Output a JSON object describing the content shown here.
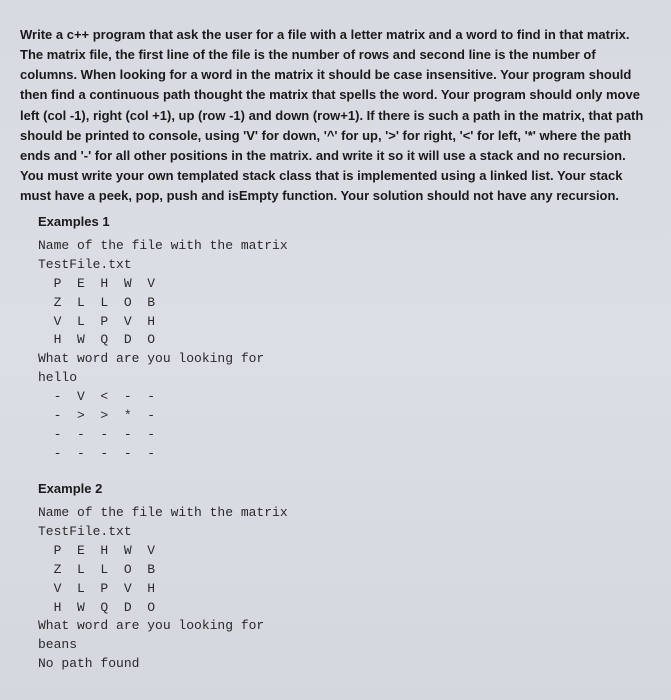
{
  "instructions": "Write a c++ program that ask the user for a file with a letter matrix and a word to find in that matrix. The matrix file, the first line of the file is the number of rows and second line is the number of columns. When looking for a word in the matrix it should be case insensitive. Your program should then find a continuous path thought the matrix that spells the word. Your program should only move left (col -1), right (col +1), up (row -1) and down (row+1). If there is such a path in the matrix, that path should be printed to console, using 'V' for down, '^' for up, '>' for right, '<' for left, '*' where the path ends and '-' for all other positions in the matrix. and write it so it will use a stack and no recursion. You must write your own templated stack class that is implemented using a linked list. Your stack must have a peek, pop, push and isEmpty function. Your solution should not have any recursion.",
  "examples": [
    {
      "label": "Examples 1",
      "prompt_file": "Name of the file with the matrix",
      "filename": "TestFile.txt",
      "matrix": [
        "  P  E  H  W  V",
        "  Z  L  L  O  B",
        "  V  L  P  V  H",
        "  H  W  Q  D  O"
      ],
      "prompt_word": "What word are you looking for",
      "word": "hello",
      "output": [
        "  -  V  <  -  -",
        "  -  >  >  *  -",
        "  -  -  -  -  -",
        "  -  -  -  -  -"
      ]
    },
    {
      "label": "Example 2",
      "prompt_file": "Name of the file with the matrix",
      "filename": "TestFile.txt",
      "matrix": [
        "  P  E  H  W  V",
        "  Z  L  L  O  B",
        "  V  L  P  V  H",
        "  H  W  Q  D  O"
      ],
      "prompt_word": "What word are you looking for",
      "word": "beans",
      "output": [
        "No path found"
      ]
    }
  ]
}
